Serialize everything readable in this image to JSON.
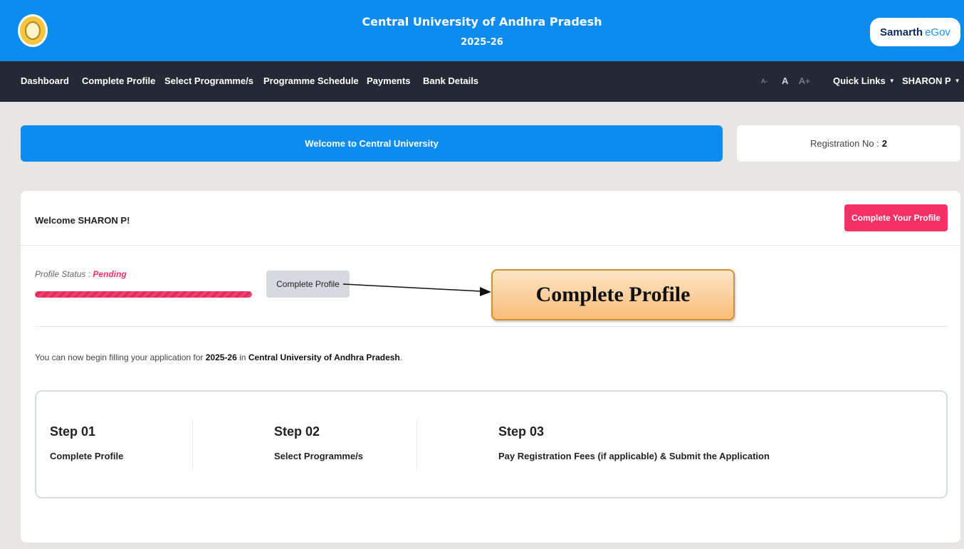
{
  "header": {
    "title": "Central University of Andhra Pradesh",
    "year": "2025-26",
    "brand_main": "Samarth",
    "brand_sub": "eGov",
    "logo_icon": "university-emblem-icon",
    "accent_color": "#0d8cf0"
  },
  "nav": {
    "items": [
      "Dashboard",
      "Complete Profile",
      "Select Programme/s",
      "Programme Schedule",
      "Payments",
      "Bank Details"
    ],
    "font_small": "A-",
    "font_normal": "A",
    "font_large": "A+",
    "quick_links": "Quick Links",
    "user": "SHARON P"
  },
  "welcome_bar": {
    "text": "Welcome to Central University"
  },
  "registration": {
    "label": "Registration No :",
    "value": "2"
  },
  "card": {
    "greeting": "Welcome SHARON P!",
    "complete_button": "Complete Your Profile",
    "status_label": "Profile Status :",
    "status_value": "Pending",
    "status_color": "#f53165",
    "progress_percent": 100,
    "profile_button": "Complete Profile",
    "info_prefix": "You can now begin filling your application for",
    "info_year": "2025-26",
    "info_mid": "in",
    "info_university": "Central University of Andhra Pradesh",
    "info_suffix": "."
  },
  "steps": [
    {
      "title": "Step 01",
      "desc": "Complete Profile"
    },
    {
      "title": "Step 02",
      "desc": "Select Programme/s"
    },
    {
      "title": "Step 03",
      "desc": "Pay Registration Fees (if applicable) & Submit the Application"
    }
  ],
  "annotation": {
    "label": "Complete Profile"
  }
}
